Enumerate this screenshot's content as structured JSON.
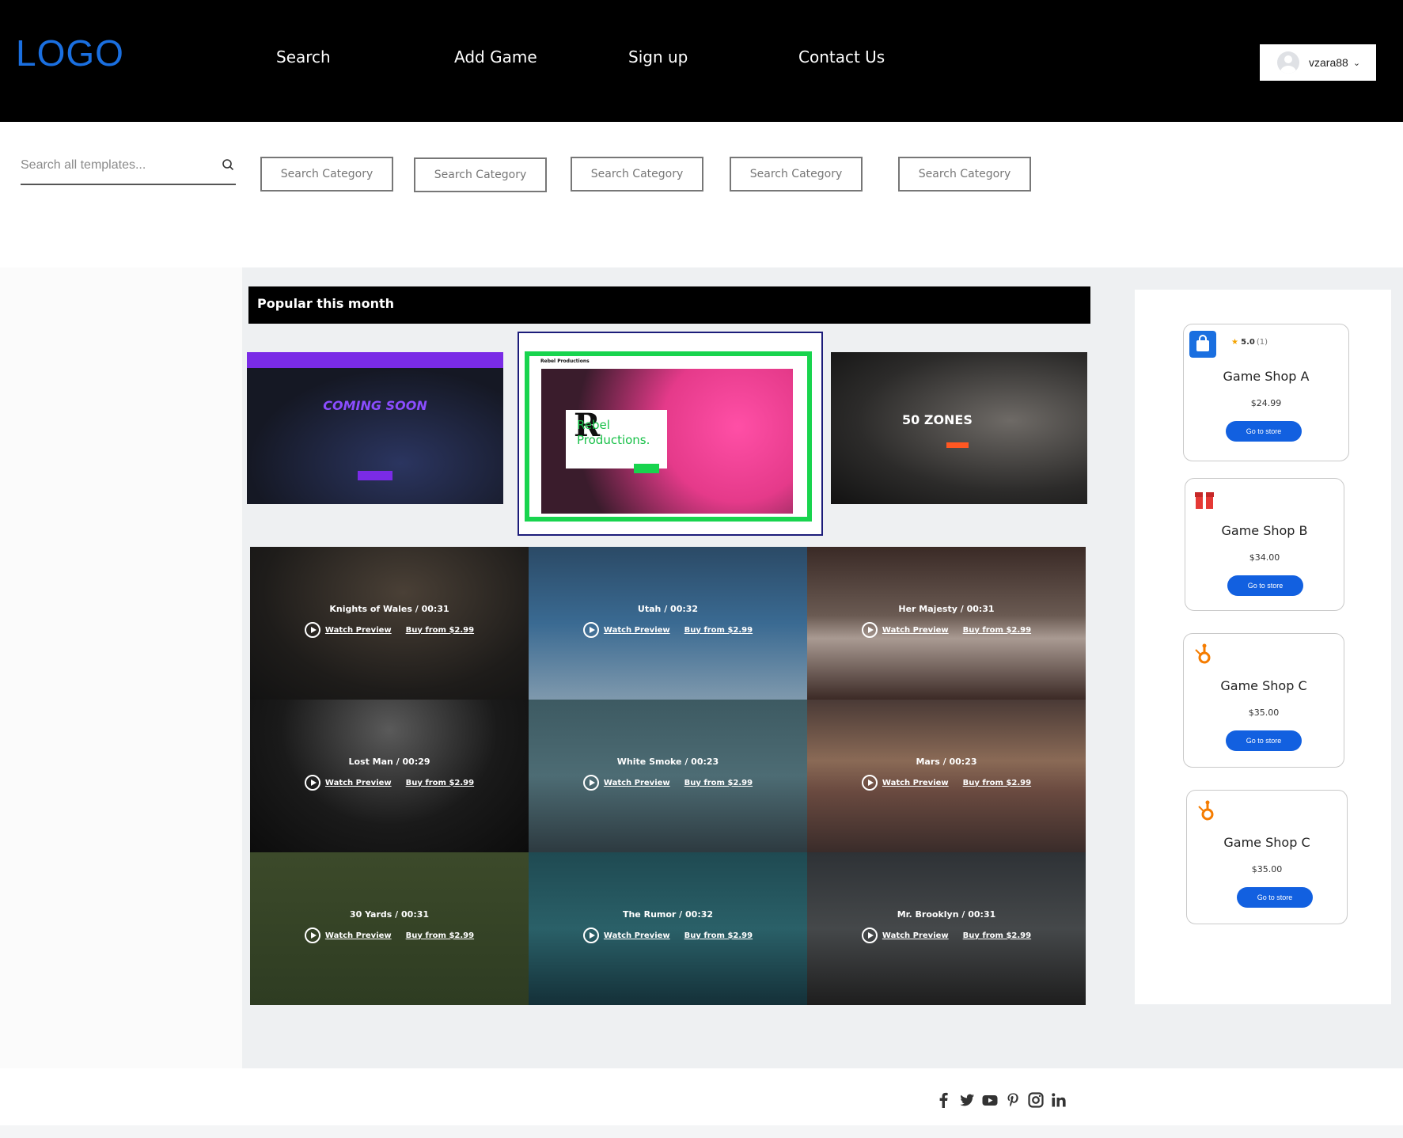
{
  "header": {
    "logo": "LOGO",
    "nav": [
      "Search",
      "Add Game",
      "Sign up",
      "Contact Us"
    ],
    "user": {
      "name": "vzara88"
    }
  },
  "search": {
    "placeholder": "Search all templates...",
    "categories": [
      "Search Category",
      "Search Category",
      "Search Category",
      "Search Category",
      "Search Category"
    ]
  },
  "popular": {
    "title": "Popular this month",
    "slides": [
      {
        "heading": "COMING SOON"
      },
      {
        "brand": "Rebel Productions",
        "letter": "R",
        "heading": "Rebel Productions."
      },
      {
        "heading": "50 ZONES"
      }
    ]
  },
  "videos": [
    {
      "title": "Knights of Wales / 00:31",
      "preview": "Watch Preview",
      "buy": "Buy from $2.99"
    },
    {
      "title": "Utah / 00:32",
      "preview": "Watch Preview",
      "buy": "Buy from $2.99"
    },
    {
      "title": "Her Majesty / 00:31",
      "preview": "Watch Preview",
      "buy": "Buy from $2.99"
    },
    {
      "title": "Lost Man / 00:29",
      "preview": "Watch Preview",
      "buy": "Buy from $2.99"
    },
    {
      "title": "White Smoke / 00:23",
      "preview": "Watch Preview",
      "buy": "Buy from $2.99"
    },
    {
      "title": "Mars / 00:23",
      "preview": "Watch Preview",
      "buy": "Buy from $2.99"
    },
    {
      "title": "30 Yards / 00:31",
      "preview": "Watch Preview",
      "buy": "Buy from $2.99"
    },
    {
      "title": "The Rumor / 00:32",
      "preview": "Watch Preview",
      "buy": "Buy from $2.99"
    },
    {
      "title": "Mr. Brooklyn / 00:31",
      "preview": "Watch Preview",
      "buy": "Buy from $2.99"
    }
  ],
  "shops": [
    {
      "name": "Game Shop A",
      "price": "$24.99",
      "button": "Go to store",
      "rating": "5.0",
      "rating_count": "(1)",
      "icon": "shopping-bag-icon",
      "icon_color": "#1a6fe0"
    },
    {
      "name": "Game Shop B",
      "price": "$34.00",
      "button": "Go to store",
      "icon": "gift-box-icon",
      "icon_color": "#e53935"
    },
    {
      "name": "Game Shop C",
      "price": "$35.00",
      "button": "Go to store",
      "icon": "hubspot-logo-icon",
      "icon_color": "#f57c00"
    },
    {
      "name": "Game Shop C",
      "price": "$35.00",
      "button": "Go to store",
      "icon": "hubspot-logo-icon",
      "icon_color": "#f57c00"
    }
  ],
  "footer": {
    "social": [
      "facebook-icon",
      "twitter-icon",
      "youtube-icon",
      "pinterest-icon",
      "instagram-icon",
      "linkedin-icon"
    ]
  }
}
